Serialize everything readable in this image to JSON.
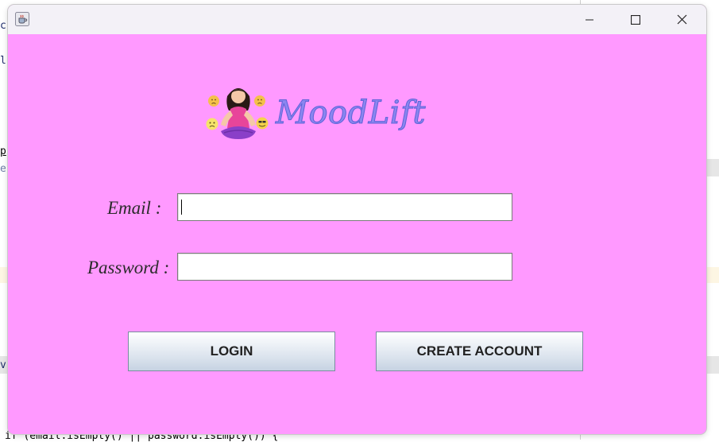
{
  "background_editor": {
    "fragments": [
      "c",
      "l",
      "p",
      "e",
      "v",
      "if (email.isEmpty() || password.isEmpty()) {"
    ]
  },
  "window": {
    "app_icon": "java-coffee-icon",
    "controls": {
      "minimize_icon": "minimize-icon",
      "maximize_icon": "maximize-icon",
      "close_icon": "close-icon"
    }
  },
  "logo": {
    "art_icon": "meditating-girl-with-emoji-faces-logo",
    "text": "MoodLift"
  },
  "form": {
    "email_label": "Email  :",
    "email_value": "",
    "password_label": "Password :",
    "password_value": ""
  },
  "buttons": {
    "login_label": "LOGIN",
    "create_account_label": "CREATE ACCOUNT"
  },
  "colors": {
    "window_background": "#ff99ff",
    "titlebar": "#f3f1f7",
    "logo_text": "#8a86f0"
  }
}
